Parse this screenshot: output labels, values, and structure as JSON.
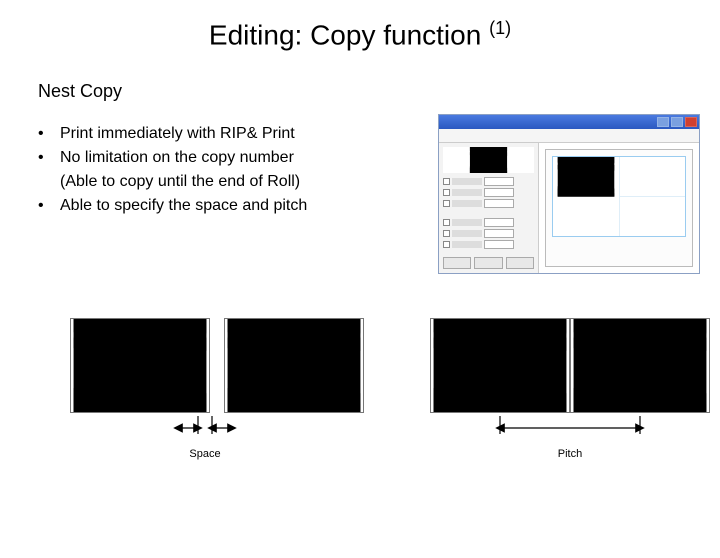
{
  "title_main": "Editing: Copy function ",
  "title_sup": "(1)",
  "subtitle": "Nest Copy",
  "bullets": [
    "Print immediately with RIP& Print",
    "No limitation on the copy number",
    "(Able to copy until the end of Roll)",
    "Able to specify the space and pitch"
  ],
  "labels": {
    "space": "Space",
    "pitch": "Pitch"
  }
}
